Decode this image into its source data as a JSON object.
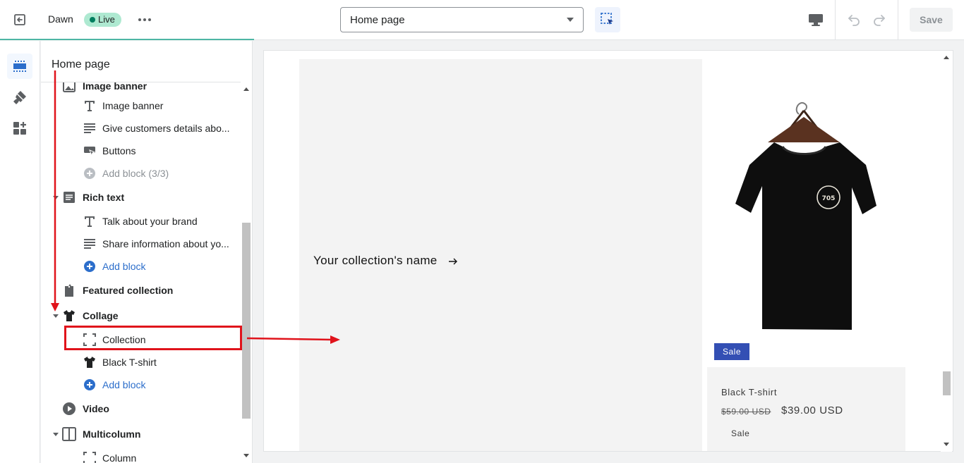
{
  "topbar": {
    "theme_name": "Dawn",
    "live_label": "Live",
    "page_select_value": "Home page",
    "save_label": "Save"
  },
  "panel": {
    "title": "Home page",
    "rows": [
      {
        "label": "Image banner",
        "icon": "image-icon",
        "kind": "section-partial"
      },
      {
        "label": "Image banner",
        "icon": "text-icon",
        "kind": "block"
      },
      {
        "label": "Give customers details abo...",
        "icon": "paragraph-icon",
        "kind": "block"
      },
      {
        "label": "Buttons",
        "icon": "button-icon",
        "kind": "block"
      },
      {
        "label": "Add block (3/3)",
        "icon": "plus-circle-icon",
        "kind": "add-disabled"
      },
      {
        "label": "Rich text",
        "icon": "rich-text-icon",
        "kind": "section"
      },
      {
        "label": "Talk about your brand",
        "icon": "text-icon",
        "kind": "block"
      },
      {
        "label": "Share information about yo...",
        "icon": "paragraph-icon",
        "kind": "block"
      },
      {
        "label": "Add block",
        "icon": "plus-circle-icon",
        "kind": "add"
      },
      {
        "label": "Featured collection",
        "icon": "tag-icon",
        "kind": "section"
      },
      {
        "label": "Collage",
        "icon": "shirt-icon",
        "kind": "section"
      },
      {
        "label": "Collection",
        "icon": "frame-icon",
        "kind": "block"
      },
      {
        "label": "Black T-shirt",
        "icon": "shirt-icon",
        "kind": "block"
      },
      {
        "label": "Add block",
        "icon": "plus-circle-icon",
        "kind": "add"
      },
      {
        "label": "Video",
        "icon": "play-icon",
        "kind": "section"
      },
      {
        "label": "Multicolumn",
        "icon": "columns-icon",
        "kind": "section"
      },
      {
        "label": "Column",
        "icon": "frame-icon",
        "kind": "block"
      }
    ]
  },
  "preview": {
    "collection_name": "Your collection's name",
    "sale_badge": "Sale",
    "product_title": "Black T-shirt",
    "price_old": "$59.00 USD",
    "price_new": "$39.00 USD",
    "sale_text": "Sale",
    "shirt_print": "705"
  },
  "colors": {
    "accent_blue": "#2c6ecb",
    "sale_blue": "#334fb4",
    "annotation_red": "#e0131b",
    "live_green": "#aee9d1"
  }
}
